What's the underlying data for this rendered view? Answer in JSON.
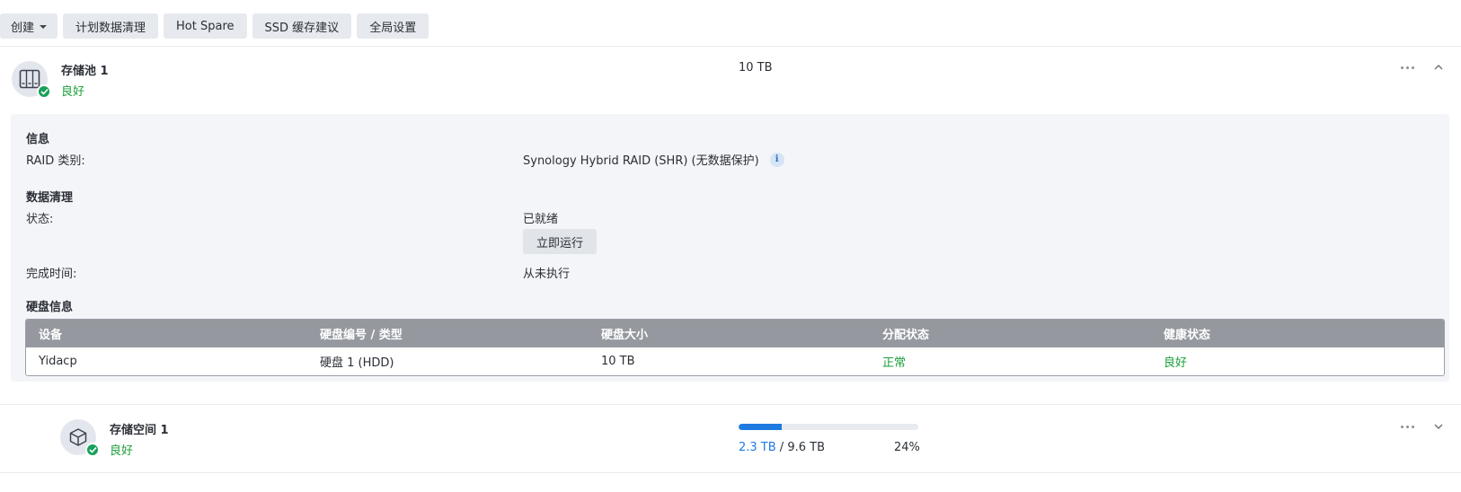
{
  "toolbar": {
    "create": "创建",
    "scrub_schedule": "计划数据清理",
    "hot_spare": "Hot Spare",
    "ssd_cache": "SSD 缓存建议",
    "global_settings": "全局设置"
  },
  "pool": {
    "name": "存储池 1",
    "status": "良好",
    "capacity": "10 TB",
    "info_section": "信息",
    "raid_label": "RAID 类别:",
    "raid_value": "Synology Hybrid RAID (SHR) (无数据保护)",
    "scrub_section": "数据清理",
    "state_label": "状态:",
    "state_value": "已就绪",
    "run_now": "立即运行",
    "finish_label": "完成时间:",
    "finish_value": "从未执行",
    "disk_section": "硬盘信息",
    "disk_table": {
      "headers": [
        "设备",
        "硬盘编号 / 类型",
        "硬盘大小",
        "分配状态",
        "健康状态"
      ],
      "rows": [
        [
          "Yidacp",
          "硬盘 1 (HDD)",
          "10 TB",
          "正常",
          "良好"
        ]
      ]
    }
  },
  "volume": {
    "name": "存储空间 1",
    "status": "良好",
    "used": "2.3 TB",
    "separator": " / ",
    "total": "9.6 TB",
    "percent": "24%",
    "usage_fraction": 0.24
  },
  "colors": {
    "ok": "#1a9e3a",
    "accent": "#1f7ae0",
    "table_header": "#95999f"
  },
  "icons": {
    "pool": "storage-pool-icon",
    "volume": "volume-cube-icon",
    "status_ok": "check-icon",
    "more": "more-icon",
    "collapse": "chevron-up-icon",
    "expand": "chevron-down-icon",
    "info": "info-icon"
  }
}
